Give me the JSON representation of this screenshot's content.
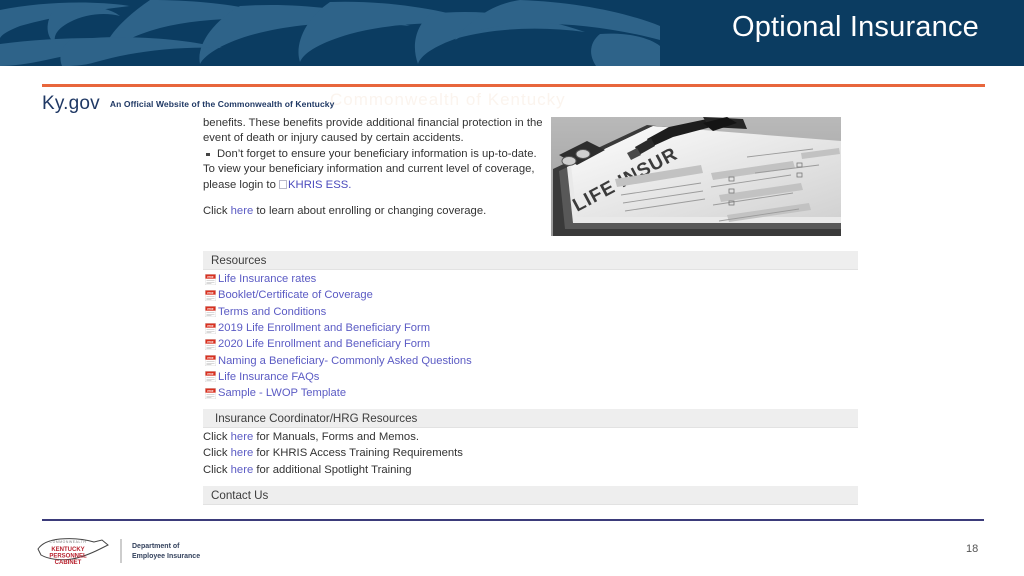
{
  "slide": {
    "title": "Optional Insurance",
    "page_number": "18",
    "banner_color": "#0b3c61",
    "banner_art_color": "#2d6289",
    "accent_orange": "#e8663c",
    "rule_navy": "#3b3b7a",
    "link_color": "#5b5bc4",
    "section_bar_color": "#eeeeee"
  },
  "site_header": {
    "logo_ky": "Ky",
    "logo_gov": ".gov",
    "tagline": "An Official Website of the Commonwealth of Kentucky",
    "ghost_text": "Commonwealth of Kentucky"
  },
  "body": {
    "paragraph_continued": "benefits. These benefits provide additional financial protection in the event of death or injury caused by certain accidents.",
    "bullets": [
      "Don’t forget to ensure your beneficiary information is up-to-date."
    ],
    "beneficiary_text_before": "To view your beneficiary information and current level of coverage, please login to ",
    "khris_link": "KHRIS ESS.",
    "click_prefix": "Click ",
    "here_label": "here",
    "click_suffix": " to learn about enrolling or changing coverage."
  },
  "photo": {
    "alt": "life-insurance-form-clipboard-photo",
    "form_text": "LIFE INSUR"
  },
  "resources_section": {
    "heading": "Resources",
    "items": [
      {
        "label": "Life Insurance rates",
        "icon": "pdf-icon"
      },
      {
        "label": "Booklet/Certificate of Coverage",
        "icon": "pdf-icon"
      },
      {
        "label": "Terms and Conditions",
        "icon": "pdf-icon"
      },
      {
        "label": "2019 Life Enrollment and Beneficiary Form",
        "icon": "pdf-icon"
      },
      {
        "label": "2020 Life Enrollment and Beneficiary Form",
        "icon": "pdf-icon"
      },
      {
        "label": "Naming a Beneficiary- Commonly Asked Questions",
        "icon": "pdf-icon"
      },
      {
        "label": "Life Insurance FAQs",
        "icon": "pdf-icon"
      },
      {
        "label": "Sample - LWOP Template",
        "icon": "pdf-icon"
      }
    ]
  },
  "coordinator_section": {
    "heading": "Insurance Coordinator/HRG Resources",
    "lines": [
      {
        "prefix": "Click ",
        "link": "here",
        "suffix": " for Manuals, Forms and Memos."
      },
      {
        "prefix": "Click ",
        "link": "here",
        "suffix": " for KHRIS Access Training Requirements"
      },
      {
        "prefix": "Click ",
        "link": "here",
        "suffix": " for additional Spotlight Training"
      }
    ]
  },
  "contact_section": {
    "heading": "Contact Us"
  },
  "footer": {
    "logo_line1": "KENTUCKY",
    "logo_line2": "PERSONNEL",
    "logo_line3": "CABINET",
    "dept_line1": "Department of",
    "dept_line2": "Employee Insurance"
  }
}
